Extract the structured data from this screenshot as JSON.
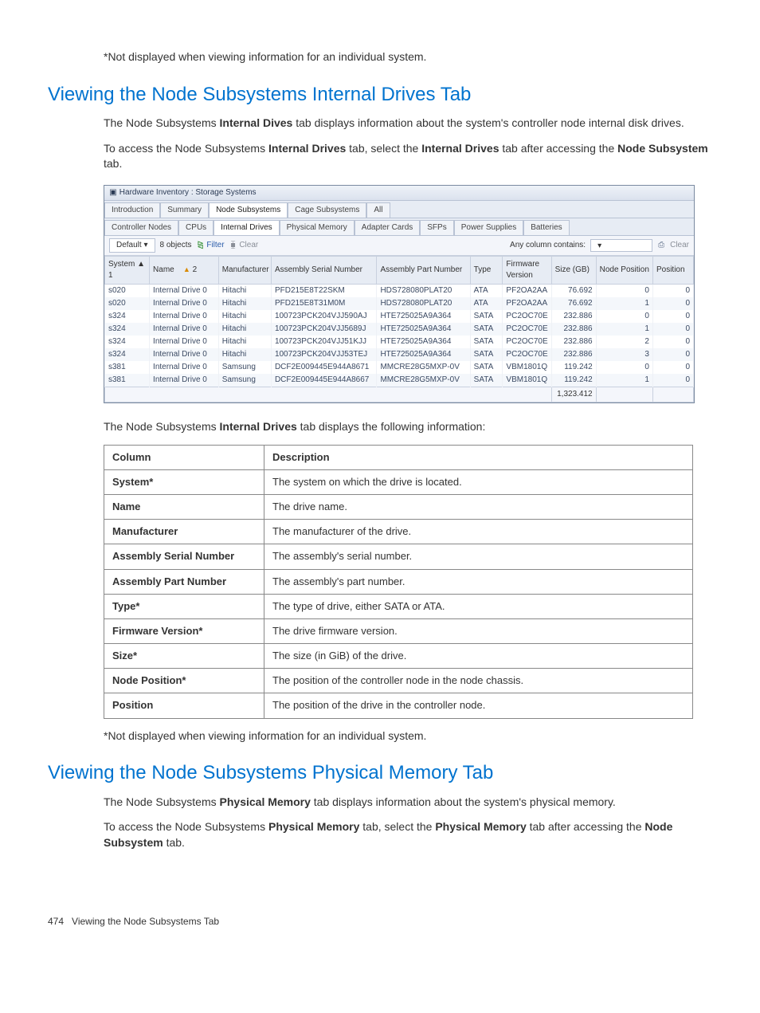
{
  "intro_footnote": "*Not displayed when viewing information for an individual system.",
  "heading1": "Viewing the Node Subsystems Internal Drives Tab",
  "para1_a": "The Node Subsystems ",
  "para1_b": "Internal Dives",
  "para1_c": " tab displays information about the system's controller node internal disk drives.",
  "para2_a": "To access the Node Subsystems ",
  "para2_b": "Internal Drives",
  "para2_c": " tab, select the ",
  "para2_d": "Internal Drives",
  "para2_e": " tab after accessing the ",
  "para2_f": "Node Subsystem",
  "para2_g": " tab.",
  "screenshot": {
    "window_title": "Hardware Inventory : Storage Systems",
    "top_tabs": [
      "Introduction",
      "Summary",
      "Node Subsystems",
      "Cage Subsystems",
      "All"
    ],
    "top_tab_active": 2,
    "sub_tabs": [
      "Controller Nodes",
      "CPUs",
      "Internal Drives",
      "Physical Memory",
      "Adapter Cards",
      "SFPs",
      "Power Supplies",
      "Batteries"
    ],
    "sub_tab_active": 2,
    "toolbar": {
      "default_btn": "Default",
      "objects": "8 objects",
      "filter": "Filter",
      "clear_filter": "Clear",
      "any_col": "Any column contains:",
      "clear_right": "Clear"
    },
    "columns": [
      "System",
      "Name",
      "Manufacturer",
      "Assembly Serial Number",
      "Assembly Part Number",
      "Type",
      "Firmware Version",
      "Size (GB)",
      "Node Position",
      "Position"
    ],
    "sort_col0": "1",
    "sort_col1": "2",
    "rows": [
      {
        "system": "s020",
        "name": "Internal Drive 0",
        "manufacturer": "Hitachi",
        "asn": "PFD215E8T22SKM",
        "apn": "HDS728080PLAT20",
        "type": "ATA",
        "fw": "PF2OA2AA",
        "size": "76.692",
        "np": "0",
        "pos": "0"
      },
      {
        "system": "s020",
        "name": "Internal Drive 0",
        "manufacturer": "Hitachi",
        "asn": "PFD215E8T31M0M",
        "apn": "HDS728080PLAT20",
        "type": "ATA",
        "fw": "PF2OA2AA",
        "size": "76.692",
        "np": "1",
        "pos": "0"
      },
      {
        "system": "s324",
        "name": "Internal Drive 0",
        "manufacturer": "Hitachi",
        "asn": "100723PCK204VJJ590AJ",
        "apn": "HTE725025A9A364",
        "type": "SATA",
        "fw": "PC2OC70E",
        "size": "232.886",
        "np": "0",
        "pos": "0"
      },
      {
        "system": "s324",
        "name": "Internal Drive 0",
        "manufacturer": "Hitachi",
        "asn": "100723PCK204VJJ5689J",
        "apn": "HTE725025A9A364",
        "type": "SATA",
        "fw": "PC2OC70E",
        "size": "232.886",
        "np": "1",
        "pos": "0"
      },
      {
        "system": "s324",
        "name": "Internal Drive 0",
        "manufacturer": "Hitachi",
        "asn": "100723PCK204VJJ51KJJ",
        "apn": "HTE725025A9A364",
        "type": "SATA",
        "fw": "PC2OC70E",
        "size": "232.886",
        "np": "2",
        "pos": "0"
      },
      {
        "system": "s324",
        "name": "Internal Drive 0",
        "manufacturer": "Hitachi",
        "asn": "100723PCK204VJJ53TEJ",
        "apn": "HTE725025A9A364",
        "type": "SATA",
        "fw": "PC2OC70E",
        "size": "232.886",
        "np": "3",
        "pos": "0"
      },
      {
        "system": "s381",
        "name": "Internal Drive 0",
        "manufacturer": "Samsung",
        "asn": "DCF2E009445E944A8671",
        "apn": "MMCRE28G5MXP-0V",
        "type": "SATA",
        "fw": "VBM1801Q",
        "size": "119.242",
        "np": "0",
        "pos": "0"
      },
      {
        "system": "s381",
        "name": "Internal Drive 0",
        "manufacturer": "Samsung",
        "asn": "DCF2E009445E944A8667",
        "apn": "MMCRE28G5MXP-0V",
        "type": "SATA",
        "fw": "VBM1801Q",
        "size": "119.242",
        "np": "1",
        "pos": "0"
      }
    ],
    "footer_total": "1,323.412"
  },
  "para3_a": "The Node Subsystems ",
  "para3_b": "Internal Drives",
  "para3_c": " tab displays the following information:",
  "doc_table": {
    "headers": [
      "Column",
      "Description"
    ],
    "rows": [
      [
        "System*",
        "The system on which the drive is located."
      ],
      [
        "Name",
        "The drive name."
      ],
      [
        "Manufacturer",
        "The manufacturer of the drive."
      ],
      [
        "Assembly Serial Number",
        "The assembly's serial number."
      ],
      [
        "Assembly Part Number",
        "The assembly's part number."
      ],
      [
        "Type*",
        "The type of drive, either SATA or ATA."
      ],
      [
        "Firmware Version*",
        "The drive firmware version."
      ],
      [
        "Size*",
        "The size (in GiB) of the drive."
      ],
      [
        "Node Position*",
        "The position of the controller node in the node chassis."
      ],
      [
        "Position",
        "The position of the drive in the controller node."
      ]
    ]
  },
  "footnote2": "*Not displayed when viewing information for an individual system.",
  "heading2": "Viewing the Node Subsystems Physical Memory Tab",
  "para4_a": "The Node Subsystems ",
  "para4_b": "Physical Memory",
  "para4_c": " tab displays information about the system's physical memory.",
  "para5_a": "To access the Node Subsystems ",
  "para5_b": "Physical Memory",
  "para5_c": " tab, select the ",
  "para5_d": "Physical Memory",
  "para5_e": " tab after accessing the ",
  "para5_f": "Node Subsystem",
  "para5_g": " tab.",
  "footer": {
    "page": "474",
    "title": "Viewing the Node Subsystems Tab"
  }
}
